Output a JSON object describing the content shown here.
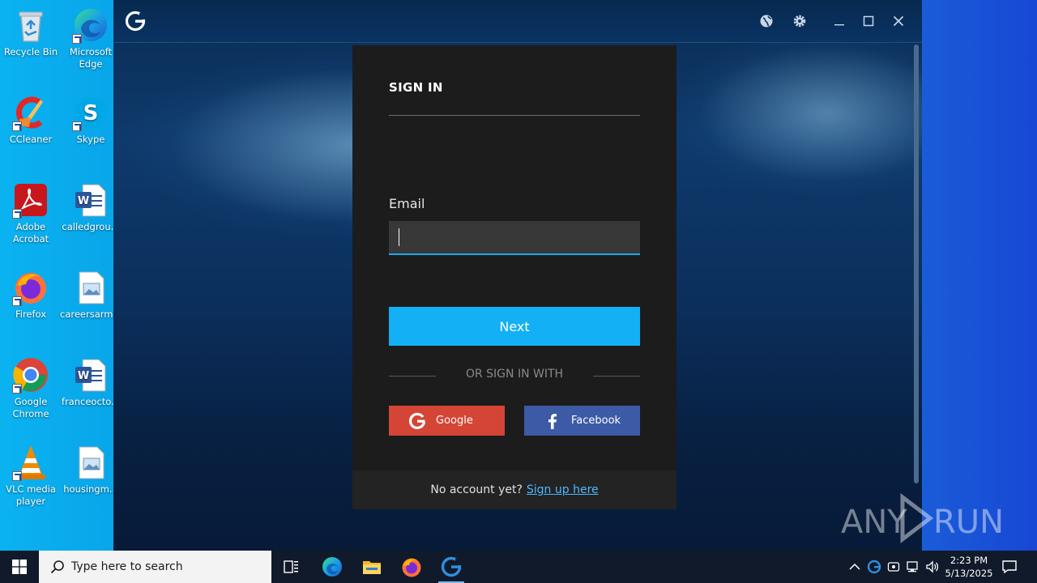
{
  "desktop": {
    "icons": [
      {
        "label": "Recycle Bin",
        "icon": "recycle-bin-icon"
      },
      {
        "label": "Microsoft Edge",
        "icon": "edge-icon"
      },
      {
        "label": "CCleaner",
        "icon": "ccleaner-icon"
      },
      {
        "label": "Skype",
        "icon": "skype-icon"
      },
      {
        "label": "Adobe Acrobat",
        "icon": "acrobat-icon"
      },
      {
        "label": "calledgrou...",
        "icon": "word-doc-icon"
      },
      {
        "label": "Firefox",
        "icon": "firefox-icon"
      },
      {
        "label": "careersarm...",
        "icon": "image-file-icon"
      },
      {
        "label": "Google Chrome",
        "icon": "chrome-icon"
      },
      {
        "label": "franceocto...",
        "icon": "word-doc-icon"
      },
      {
        "label": "VLC media player",
        "icon": "vlc-icon"
      },
      {
        "label": "housingm...",
        "icon": "image-file-icon"
      }
    ]
  },
  "app": {
    "titlebar": {
      "icons": [
        "app-logo-icon",
        "globe-icon",
        "gear-icon",
        "minimize-icon",
        "maximize-icon",
        "close-icon"
      ]
    },
    "signin": {
      "title": "SIGN IN",
      "email_label": "Email",
      "email_value": "",
      "next_label": "Next",
      "divider_text": "OR SIGN IN WITH",
      "google_label": "Google",
      "facebook_label": "Facebook",
      "footer_text": "No account yet?",
      "signup_link": "Sign up here"
    },
    "colors": {
      "accent": "#13b0f5",
      "google": "#d54536",
      "facebook": "#3c5aa6",
      "panel_bg": "#1c1c1c"
    }
  },
  "watermark": {
    "text": "ANY RUN"
  },
  "taskbar": {
    "search_placeholder": "Type here to search",
    "apps": [
      "task-view-icon",
      "edge-icon",
      "file-explorer-icon",
      "firefox-icon",
      "app-logo-icon"
    ],
    "tray_icons": [
      "chevron-up-icon",
      "app-tray-icon",
      "meet-now-icon",
      "network-icon",
      "volume-icon"
    ],
    "time": "2:23 PM",
    "date": "5/13/2025"
  }
}
